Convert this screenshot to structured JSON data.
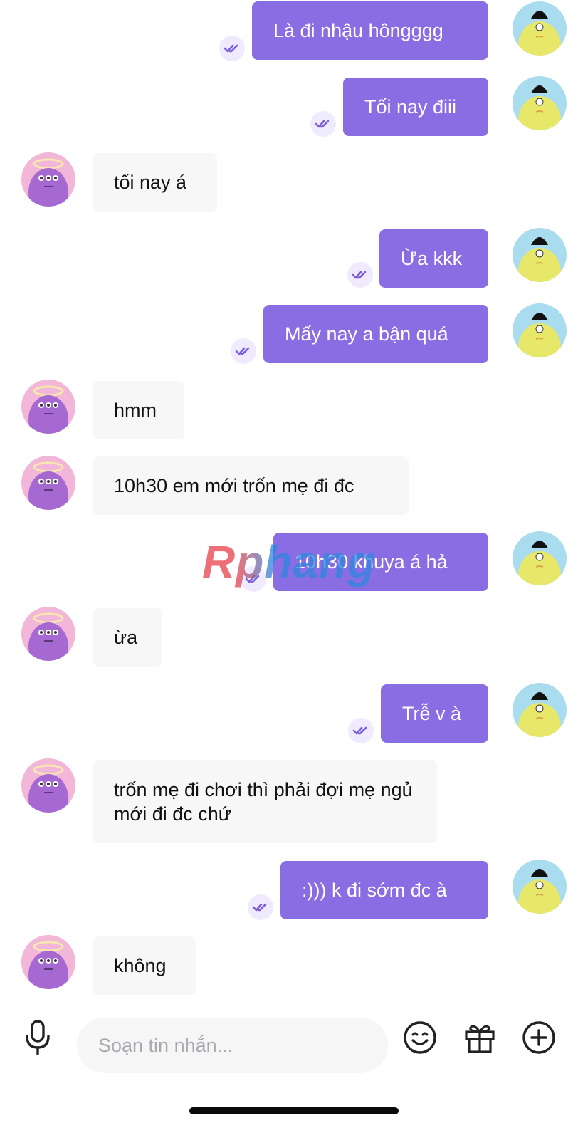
{
  "messages": [
    {
      "text": "Là đi nhậu hôngggg"
    },
    {
      "text": "Tối nay điii"
    },
    {
      "text": "tối nay á"
    },
    {
      "text": "Ừa kkk"
    },
    {
      "text": "Mấy nay a bận quá"
    },
    {
      "text": "hmm"
    },
    {
      "text": "10h30 em mới trốn mẹ đi đc"
    },
    {
      "text": "10h30 khuya á hả"
    },
    {
      "text": "ừa"
    },
    {
      "text": "Trễ v à"
    },
    {
      "text": "trốn mẹ đi chơi thì phải đợi mẹ ngủ mới đi đc chứ"
    },
    {
      "text": ":))) k đi sớm đc à"
    },
    {
      "text": "không"
    }
  ],
  "watermark": "Rphang",
  "composer": {
    "placeholder": "Soạn tin nhắn..."
  },
  "colors": {
    "outgoing_bubble": "#8a6de3",
    "incoming_bubble": "#f7f7f8",
    "accent": "#8a6de3"
  },
  "icons": {
    "mic": "microphone-icon",
    "emoji": "smiley-icon",
    "gift": "gift-icon",
    "add": "plus-circle-icon",
    "read": "double-check-icon"
  }
}
